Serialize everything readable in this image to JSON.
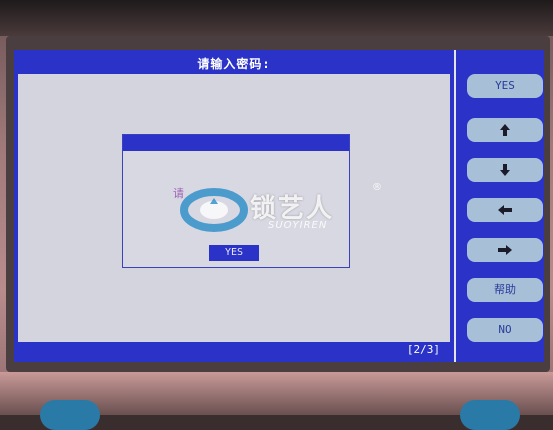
{
  "screen": {
    "title": "请输入密码:",
    "page_indicator": "[2/3]"
  },
  "dialog": {
    "message_line1": "请",
    "message_line2": "",
    "confirm_label": "YES"
  },
  "watermark": {
    "brand": "锁艺人",
    "sub": "SUOYIREN",
    "reg_mark": "®"
  },
  "side_menu": {
    "yes_label": "YES",
    "up_icon": "arrow-up-icon",
    "down_icon": "arrow-down-icon",
    "left_icon": "arrow-left-icon",
    "right_icon": "arrow-right-icon",
    "help_label": "帮助",
    "no_label": "NO"
  },
  "colors": {
    "frame_blue": "#2a32c8",
    "button_face": "#a7c0d8",
    "screen_bg": "#d4d4de"
  }
}
